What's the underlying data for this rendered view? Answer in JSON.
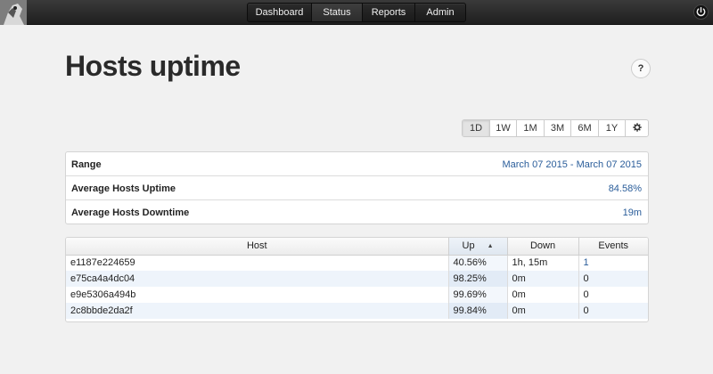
{
  "nav": {
    "logo_icon": "user-avatar-icon",
    "tabs": [
      {
        "label": "Dashboard"
      },
      {
        "label": "Status"
      },
      {
        "label": "Reports"
      },
      {
        "label": "Admin"
      }
    ],
    "power_icon": "power-icon"
  },
  "page": {
    "title": "Hosts uptime",
    "help_label": "?"
  },
  "range": {
    "buttons": [
      "1D",
      "1W",
      "1M",
      "3M",
      "6M",
      "1Y"
    ],
    "selected": "1D",
    "settings_icon": "gear-icon"
  },
  "summary": {
    "rows": [
      {
        "label": "Range",
        "value": "March 07 2015 - March 07 2015"
      },
      {
        "label": "Average Hosts Uptime",
        "value": "84.58%"
      },
      {
        "label": "Average Hosts Downtime",
        "value": "19m"
      }
    ]
  },
  "hosts_table": {
    "columns": [
      "Host",
      "Up",
      "Down",
      "Events"
    ],
    "sorted_column": "Up",
    "sort_direction": "ascending",
    "rows": [
      {
        "host": "e1187e224659",
        "up": "40.56%",
        "down": "1h, 15m",
        "events": "1"
      },
      {
        "host": "e75ca4a4dc04",
        "up": "98.25%",
        "down": "0m",
        "events": "0"
      },
      {
        "host": "e9e5306a494b",
        "up": "99.69%",
        "down": "0m",
        "events": "0"
      },
      {
        "host": "2c8bbde2da2f",
        "up": "99.84%",
        "down": "0m",
        "events": "0"
      }
    ]
  },
  "colors": {
    "link": "#2a5d9a",
    "navbar": "#2a2a2a",
    "background": "#f1f1f1"
  }
}
